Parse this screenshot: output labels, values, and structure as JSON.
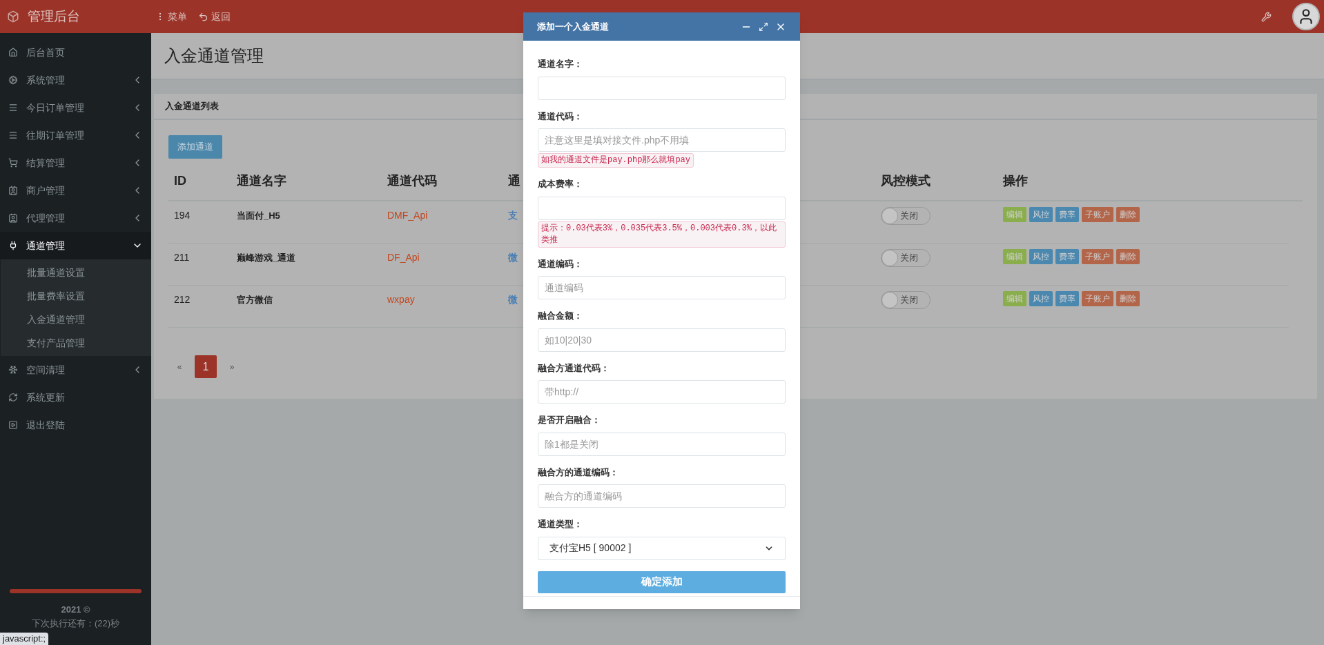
{
  "topbar": {
    "brand": "管理后台",
    "menu": "菜单",
    "back": "返回"
  },
  "sidebar": {
    "items": [
      {
        "label": "后台首页",
        "kind": "link",
        "selected": false
      },
      {
        "label": "系统管理",
        "kind": "group",
        "selected": false,
        "expanded": false
      },
      {
        "label": "今日订单管理",
        "kind": "group",
        "selected": false,
        "expanded": false
      },
      {
        "label": "往期订单管理",
        "kind": "group",
        "selected": false,
        "expanded": false
      },
      {
        "label": "结算管理",
        "kind": "group",
        "selected": false,
        "expanded": false
      },
      {
        "label": "商户管理",
        "kind": "group",
        "selected": false,
        "expanded": false
      },
      {
        "label": "代理管理",
        "kind": "group",
        "selected": false,
        "expanded": false
      },
      {
        "label": "通道管理",
        "kind": "group",
        "selected": true,
        "expanded": true,
        "children": [
          {
            "label": "批量通道设置"
          },
          {
            "label": "批量费率设置"
          },
          {
            "label": "入金通道管理"
          },
          {
            "label": "支付产品管理"
          }
        ]
      },
      {
        "label": "空间清理",
        "kind": "group",
        "selected": false,
        "expanded": false
      },
      {
        "label": "系统更新",
        "kind": "link",
        "selected": false
      },
      {
        "label": "退出登陆",
        "kind": "link",
        "selected": false
      }
    ],
    "footer": {
      "level": 1,
      "year": "2021 ©",
      "countdown": "下次执行还有：(22)秒"
    }
  },
  "page": {
    "title": "入金通道管理"
  },
  "panel": {
    "title": "入金通道列表",
    "add_button": "添加通道",
    "table": {
      "columns": [
        "ID",
        "通道名字",
        "通道代码",
        "通",
        "风控模式",
        "操作"
      ],
      "rows": [
        {
          "id": "194",
          "name": "当面付_H5",
          "code": "DMF_Api",
          "column_4": "支",
          "risk": {
            "on": false,
            "label": "关闭"
          },
          "actions": [
            {
              "label": "编辑",
              "color": "#8aae4c"
            },
            {
              "label": "风控",
              "color": "#4a88b0"
            },
            {
              "label": "费率",
              "color": "#4a88b0"
            },
            {
              "label": "子账户",
              "color": "#b3654a"
            },
            {
              "label": "删除",
              "color": "#b3654a"
            }
          ]
        },
        {
          "id": "211",
          "name": "巅峰游戏_通道",
          "code": "DF_Api",
          "column_4": "微",
          "risk": {
            "on": false,
            "label": "关闭"
          },
          "actions": [
            {
              "label": "编辑",
              "color": "#8aae4c"
            },
            {
              "label": "风控",
              "color": "#4a88b0"
            },
            {
              "label": "费率",
              "color": "#4a88b0"
            },
            {
              "label": "子账户",
              "color": "#b3654a"
            },
            {
              "label": "删除",
              "color": "#b3654a"
            }
          ]
        },
        {
          "id": "212",
          "name": "官方微信",
          "code": "wxpay",
          "column_4": "微",
          "risk": {
            "on": false,
            "label": "关闭"
          },
          "actions": [
            {
              "label": "编辑",
              "color": "#8aae4c"
            },
            {
              "label": "风控",
              "color": "#4a88b0"
            },
            {
              "label": "费率",
              "color": "#4a88b0"
            },
            {
              "label": "子账户",
              "color": "#b3654a"
            },
            {
              "label": "删除",
              "color": "#b3654a"
            }
          ]
        }
      ]
    },
    "pagination": [
      {
        "label": "«",
        "selected": false
      },
      {
        "label": "1",
        "selected": true
      },
      {
        "label": "»",
        "selected": false
      }
    ]
  },
  "modal": {
    "title": "添加一个入金通道",
    "fields": [
      {
        "label": "通道名字：",
        "kind": "text"
      },
      {
        "label": "通道代码：",
        "kind": "text",
        "placeholder": "注意这里是填对接文件.php不用填",
        "hint": "如我的通道文件是pay.php那么就填pay"
      },
      {
        "label": "成本费率：",
        "kind": "text",
        "hint": "提示：0.03代表3%，0.035代表3.5%，0.003代表0.3%，以此类推"
      },
      {
        "label": "通道编码：",
        "kind": "text",
        "placeholder": "通道编码"
      },
      {
        "label": "融合金额：",
        "kind": "text",
        "placeholder": "如10|20|30"
      },
      {
        "label": "融合方通道代码：",
        "kind": "text",
        "placeholder": "带http://"
      },
      {
        "label": "是否开启融合：",
        "kind": "text",
        "placeholder": "除1都是关闭"
      },
      {
        "label": "融合方的通道编码：",
        "kind": "text",
        "placeholder": "融合方的通道编码"
      },
      {
        "label": "通道类型：",
        "kind": "select",
        "value": "支付宝H5 [ 90002 ]"
      }
    ],
    "submit": "确定添加"
  },
  "status_tooltip": "javascript:;"
}
